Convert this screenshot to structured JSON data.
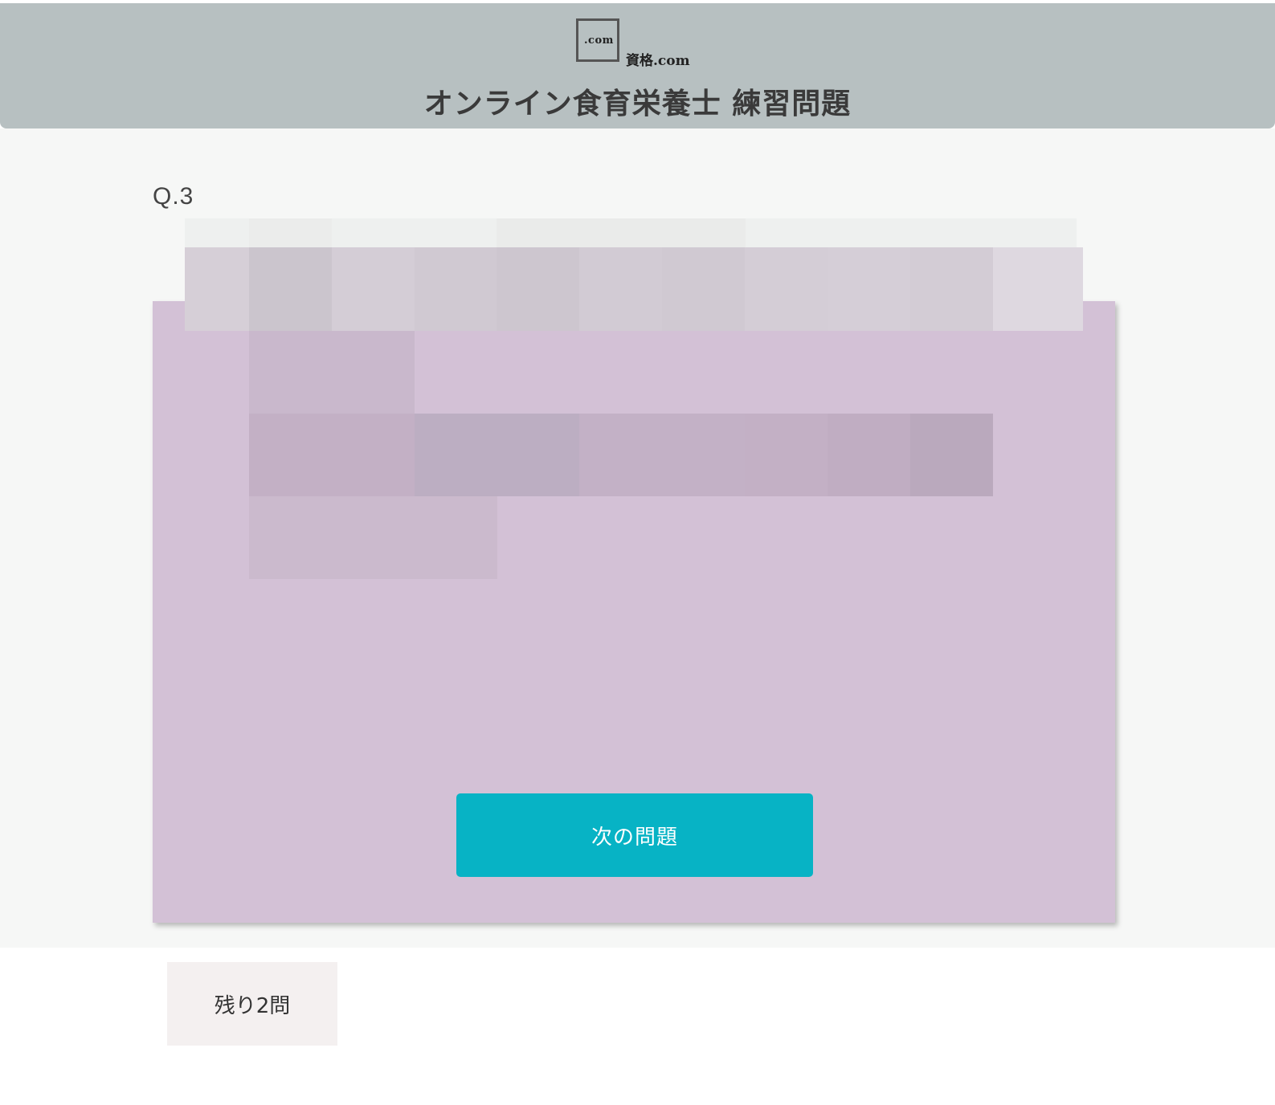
{
  "header": {
    "logo_box_text": ".com",
    "logo_text": "資格.com",
    "title": "オンライン食育栄養士 練習問題"
  },
  "question": {
    "number_label": "Q.3"
  },
  "actions": {
    "next_label": "次の問題"
  },
  "progress": {
    "remaining_label": "残り2問"
  },
  "colors": {
    "header_bg": "#b7c0c1",
    "card_bg": "#d3c1d6",
    "accent_button": "#07b3c5",
    "remaining_bg": "#f4f0f0"
  }
}
